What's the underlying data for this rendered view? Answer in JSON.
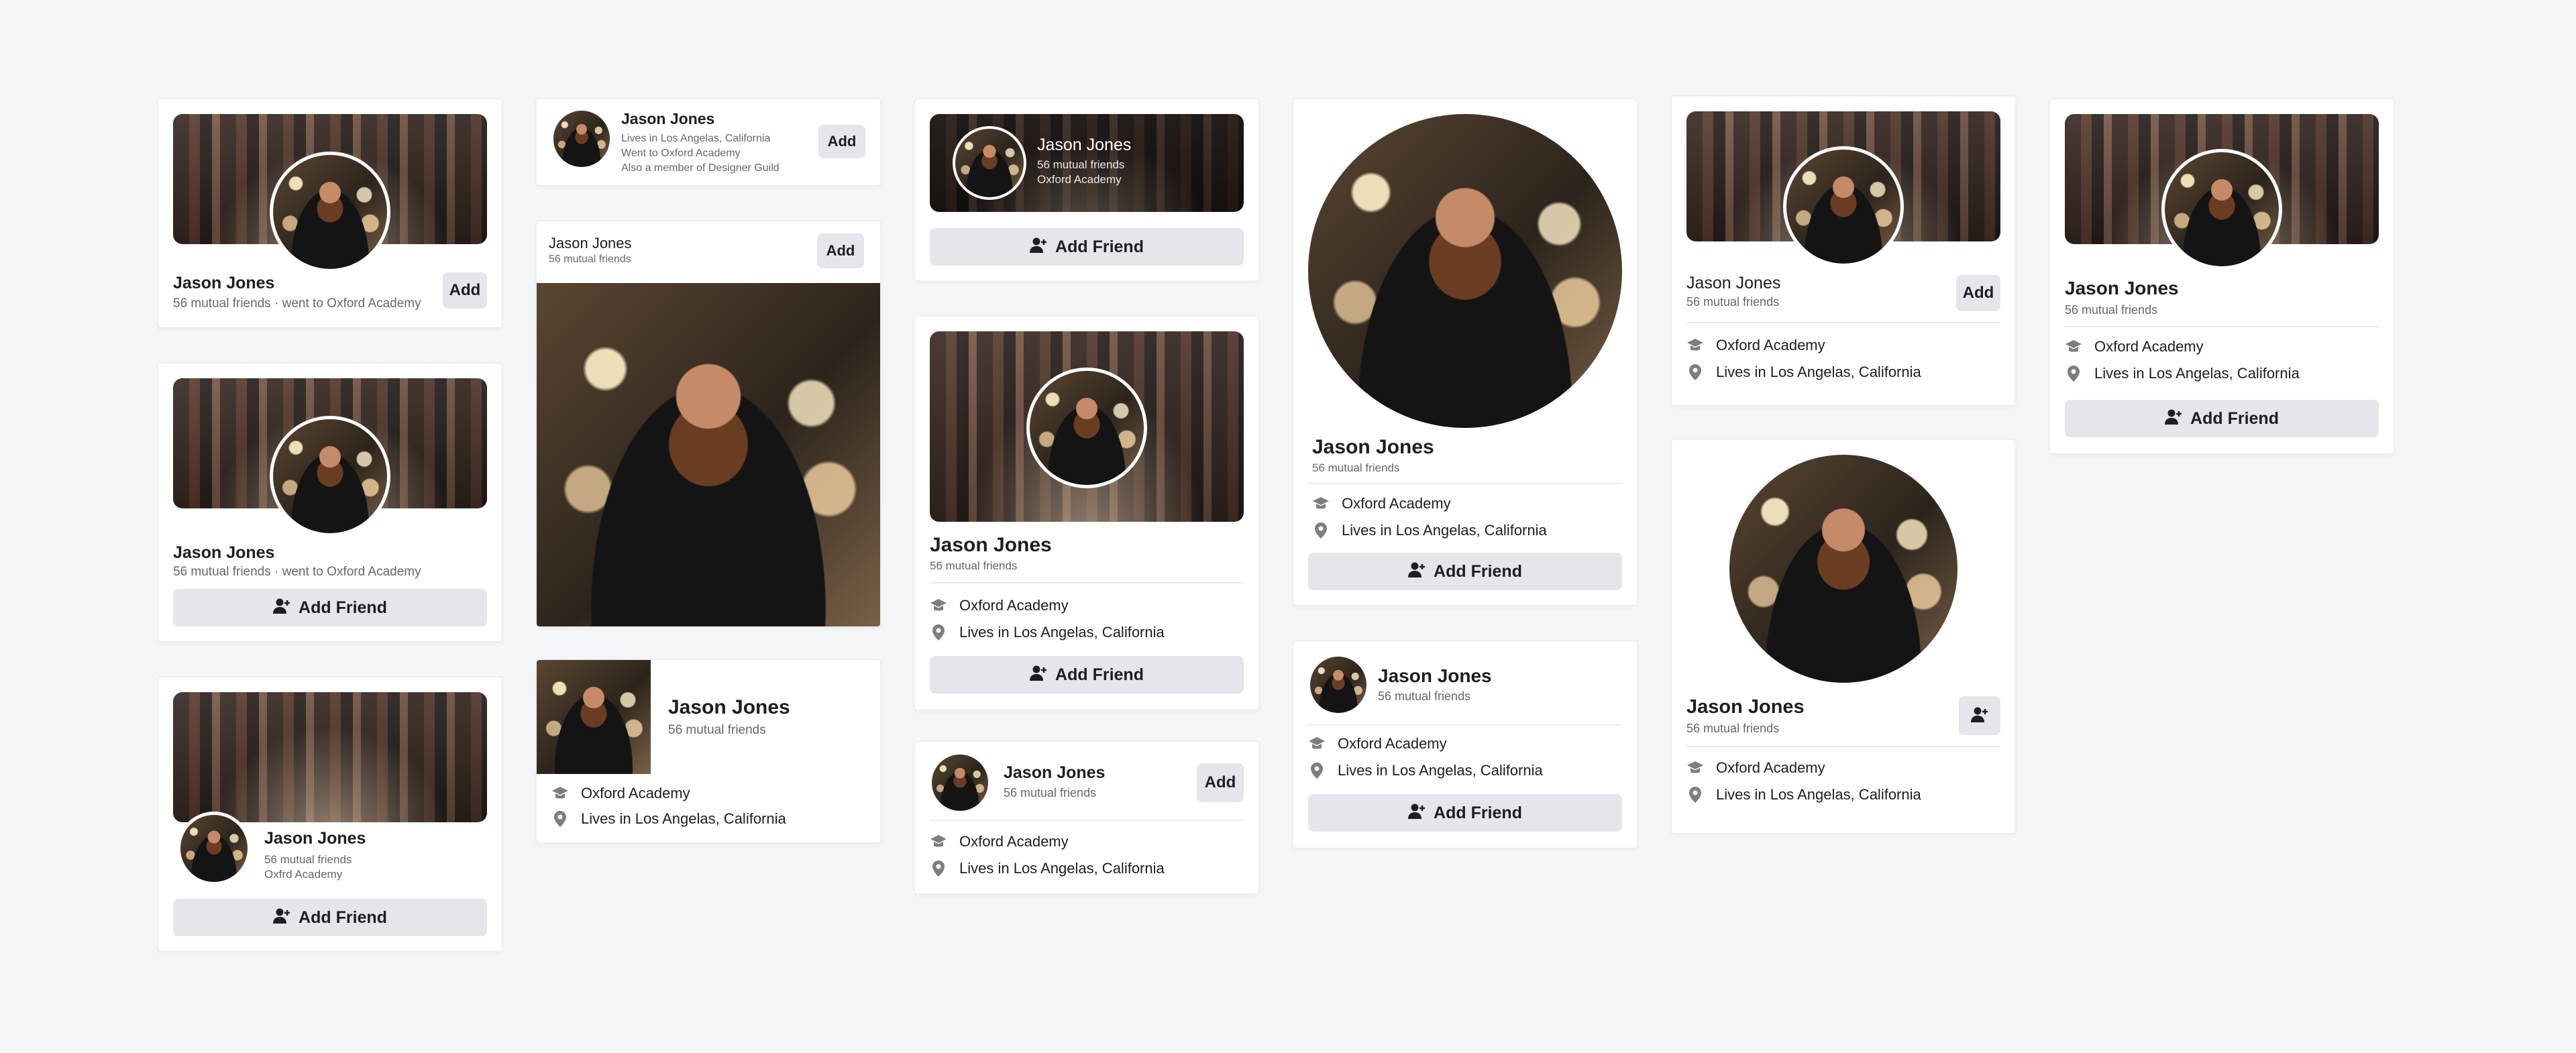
{
  "person": {
    "name": "Jason Jones",
    "mutual": "56 mutual friends",
    "mutual_school": "56 mutual friends · went to Oxford Academy",
    "school": "Oxford Academy",
    "lives": "Lives in Los Angelas, California",
    "lives_short": "Lives in Los Angelas, California",
    "went": "Went to Oxford Academy",
    "member": "Also a member of Designer Guild",
    "school_short": "Oxfrd Academy"
  },
  "buttons": {
    "add": "Add",
    "add_friend": "Add Friend"
  },
  "icons": {
    "school": "graduation-cap-icon",
    "location": "location-pin-icon",
    "add_friend": "user-plus-icon"
  },
  "colors": {
    "background": "#f5f6f8",
    "button": "#e4e6eb",
    "text_primary": "#1c1e21",
    "text_secondary": "#65676b"
  }
}
